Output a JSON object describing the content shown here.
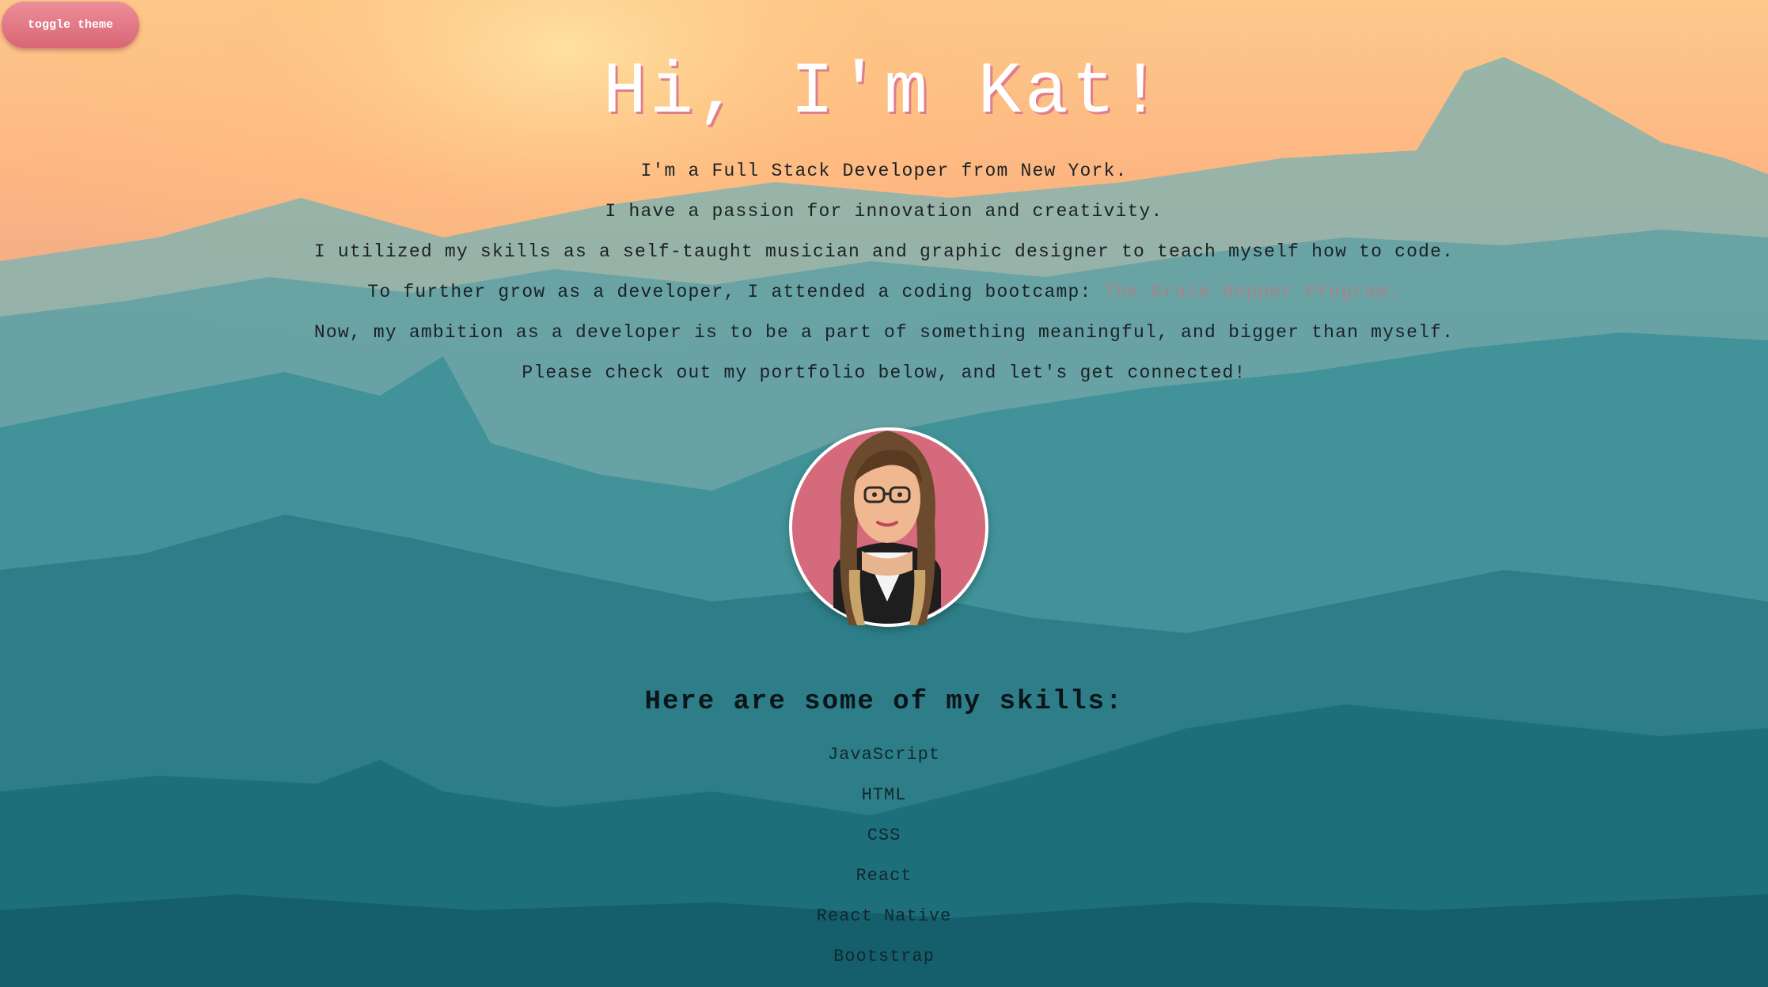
{
  "controls": {
    "toggle_theme_label": "toggle theme"
  },
  "hero": {
    "title": "Hi, I'm Kat!"
  },
  "intro": {
    "line1": "I'm a Full Stack Developer from New York.",
    "line2": "I have a passion for innovation and creativity.",
    "line3": "I utilized my skills as a self-taught musician and graphic designer to teach myself how to code.",
    "line4_text": "To further grow as a developer, I attended a coding bootcamp: ",
    "line4_link": "The Grace Hopper Program.",
    "line5": "Now, my ambition as a developer is to be a part of something meaningful, and bigger than myself.",
    "line6": "Please check out my portfolio below, and let's get connected!"
  },
  "skills": {
    "heading": "Here are some of my skills:",
    "items": [
      "JavaScript",
      "HTML",
      "CSS",
      "React",
      "React Native",
      "Bootstrap"
    ]
  },
  "colors": {
    "accent_pink": "#d96675",
    "title_shadow": "#e27d8a",
    "sky_top": "#fcc17e",
    "mountain_teal": "#1a7f89"
  }
}
